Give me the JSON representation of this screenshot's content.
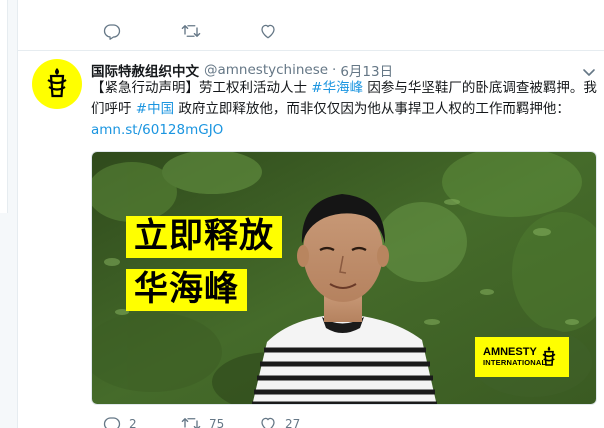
{
  "prev_tweet": {
    "actions": [
      {
        "name": "reply",
        "count": ""
      },
      {
        "name": "retweet",
        "count": ""
      },
      {
        "name": "like",
        "count": ""
      }
    ]
  },
  "tweet": {
    "display_name": "国际特赦组织中文",
    "handle": "@amnestychinese",
    "separator": "·",
    "date": "6月13日",
    "text": {
      "part1": "【紧急行动声明】劳工权利活动人士 ",
      "hashtag1": "#华海峰",
      "part2": " 因参与华坚鞋厂的卧底调查被羁押。我们呼吁 ",
      "hashtag2": "#中国",
      "part3": " 政府立即释放他，而非仅仅因为他从事捍卫人权的工作而羁押他：",
      "link": "amn.st/60128mGJO"
    },
    "media": {
      "overlay_line1": "立即释放",
      "overlay_line2": "华海峰",
      "logo_line1": "AMNESTY",
      "logo_line2": "INTERNATIONAL"
    },
    "actions": {
      "reply_count": "2",
      "retweet_count": "75",
      "like_count": "27"
    }
  },
  "colors": {
    "brand_yellow": "#ffff00",
    "link_blue": "#1b95e0",
    "secondary_text": "#657786"
  },
  "icons": [
    "reply-icon",
    "retweet-icon",
    "like-icon",
    "chevron-down-icon",
    "amnesty-candle-icon"
  ]
}
